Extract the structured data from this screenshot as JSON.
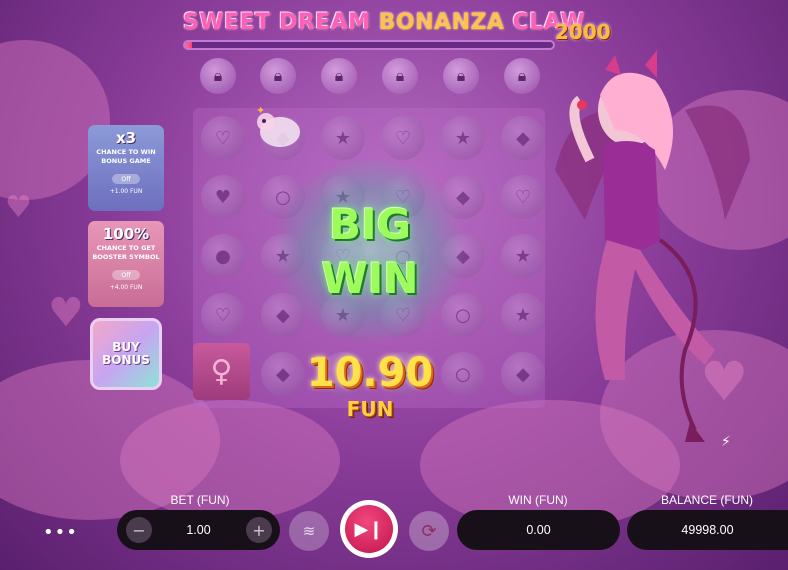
{
  "game": {
    "title_part1": "SWEET DREAM",
    "title_part2": "BONANZA",
    "title_part3": "CLAW",
    "title_suffix": "2000",
    "progress_fraction": 0.02
  },
  "side_panels": {
    "panel1": {
      "headline": "x3",
      "text": "CHANCE TO WIN BONUS GAME",
      "toggle": "Off",
      "cost": "+1.00 FUN"
    },
    "panel2": {
      "headline": "100%",
      "text": "CHANCE TO GET BOOSTER SYMBOL",
      "toggle": "Off",
      "cost": "+4.00 FUN"
    },
    "buy_bonus": "BUY BONUS"
  },
  "win_overlay": {
    "line1": "BIG",
    "line2": "WIN",
    "amount": "10.90",
    "currency": "FUN"
  },
  "bottom_bar": {
    "menu_icon": "ellipsis-icon",
    "bet_label": "BET (FUN)",
    "bet_value": "1.00",
    "minus_symbol": "−",
    "plus_symbol": "+",
    "win_label": "WIN (FUN)",
    "win_value": "0.00",
    "balance_label": "BALANCE (FUN)",
    "balance_value": "49998.00",
    "spin_icon": "play-next-icon",
    "autoplay_icon": "autoplay-icon",
    "coin_stack_icon": "coin-stack-icon"
  },
  "colors": {
    "spin_button": "#e0245e",
    "win_text": "#9dfb5b",
    "amount_text": "#ffe14a"
  }
}
